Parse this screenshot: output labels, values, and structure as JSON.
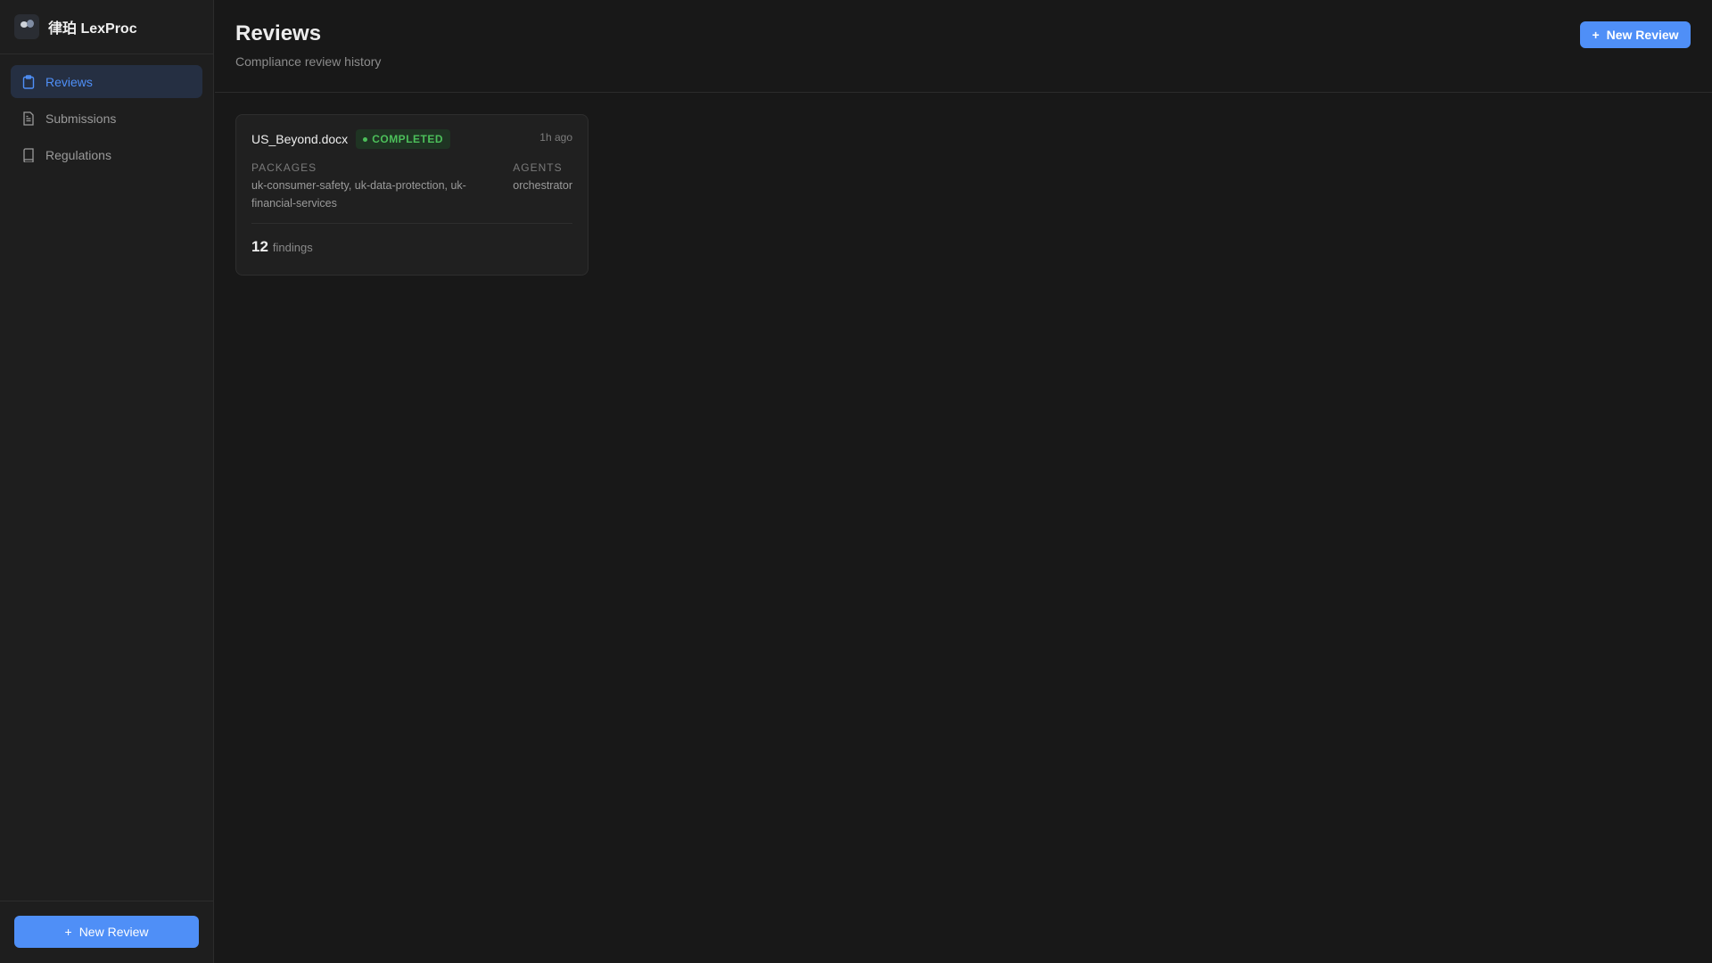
{
  "app": {
    "name": "律珀 LexProc",
    "logo_text": "LEXPROC"
  },
  "sidebar": {
    "items": [
      {
        "label": "Reviews",
        "icon": "clipboard-icon"
      },
      {
        "label": "Submissions",
        "icon": "file-text-icon"
      },
      {
        "label": "Regulations",
        "icon": "book-icon"
      }
    ],
    "new_review": "New Review"
  },
  "header": {
    "title": "Reviews",
    "subtitle": "Compliance review history",
    "new_review": "New Review"
  },
  "reviews": [
    {
      "file": "US_Beyond.docx",
      "status": "COMPLETED",
      "time": "1h ago",
      "packages_label": "PACKAGES",
      "packages": "uk-consumer-safety, uk-data-protection, uk-financial-services",
      "agents_label": "AGENTS",
      "agents": "orchestrator",
      "findings_count": "12",
      "findings_label": "findings"
    }
  ],
  "colors": {
    "accent": "#4f8ff7",
    "success": "#4cbf5a"
  }
}
